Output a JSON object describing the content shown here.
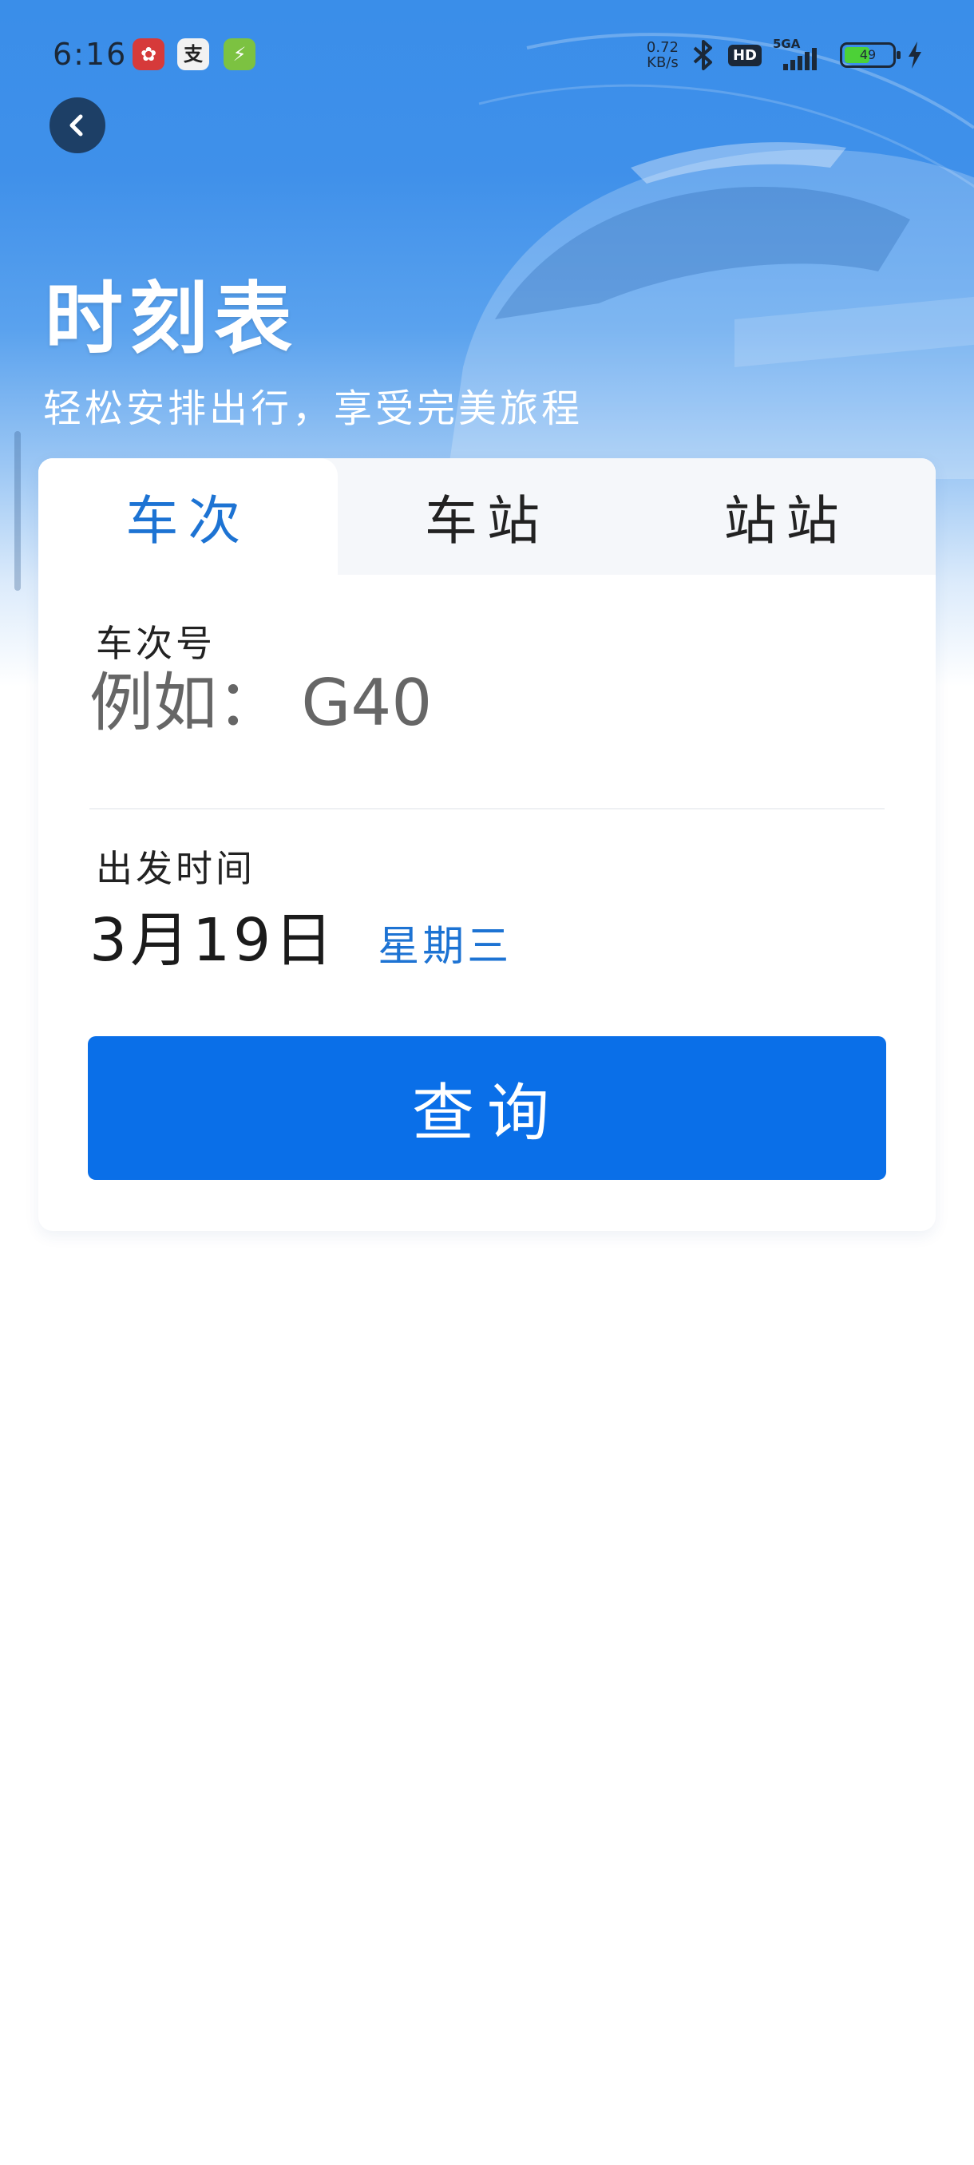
{
  "status_bar": {
    "time": "6:16",
    "app_icons": [
      "gift-app-icon",
      "store-app-icon",
      "charge-app-icon"
    ],
    "net_speed_value": "0.72",
    "net_speed_unit": "KB/s",
    "hd_label": "HD",
    "network_label": "5GA",
    "battery_percent": "49"
  },
  "header": {
    "title": "时刻表",
    "subtitle": "轻松安排出行，享受完美旅程"
  },
  "tabs": [
    {
      "label": "车次",
      "active": true
    },
    {
      "label": "车站",
      "active": false
    },
    {
      "label": "站站",
      "active": false
    }
  ],
  "form": {
    "train_number_label": "车次号",
    "train_number_placeholder": "例如： G40",
    "departure_label": "出发时间",
    "departure_date": "3月19日",
    "departure_weekday": "星期三",
    "search_label": "查询"
  },
  "colors": {
    "accent": "#0a6fe8",
    "active_tab": "#1d73d3",
    "hero_blue": "#3a8ee9"
  }
}
